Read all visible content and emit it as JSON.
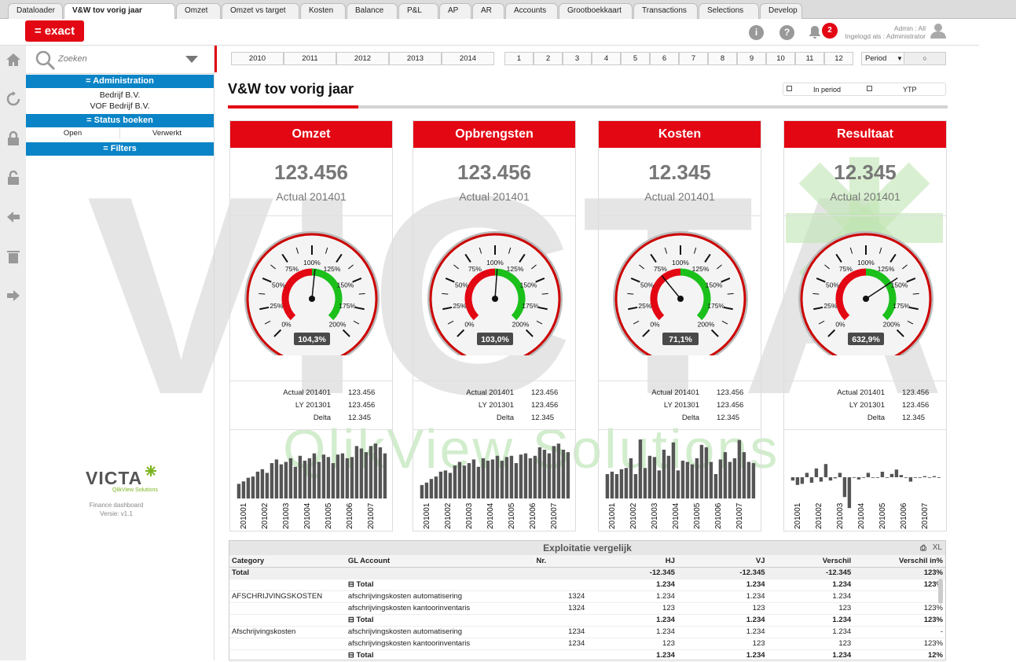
{
  "tabs": [
    {
      "label": "Dataloader",
      "active": false
    },
    {
      "label": "V&W tov vorig jaar",
      "active": true
    },
    {
      "label": "Omzet",
      "active": false
    },
    {
      "label": "Omzet vs target",
      "active": false
    },
    {
      "label": "Kosten",
      "active": false
    },
    {
      "label": "Balance",
      "active": false
    },
    {
      "label": "P&L",
      "active": false
    },
    {
      "label": "AP",
      "active": false
    },
    {
      "label": "AR",
      "active": false
    },
    {
      "label": "Accounts",
      "active": false
    },
    {
      "label": "Grootboekkaart",
      "active": false
    },
    {
      "label": "Transactions",
      "active": false
    },
    {
      "label": "Selections",
      "active": false
    },
    {
      "label": "Develop",
      "active": false
    }
  ],
  "header": {
    "logo": "= exact",
    "info_icon": "i",
    "help_icon": "?",
    "notification_count": "2",
    "user_line1": "Admin : All",
    "user_line2": "Ingelogd als : Administrator"
  },
  "sidebar": {
    "search_placeholder": "Zoeken",
    "administration_label": "= Administration",
    "companies": [
      "Bedrijf B.V.",
      "VOF Bedrijf B.V."
    ],
    "status_label": "= Status boeken",
    "status_open": "Open",
    "status_verwerkt": "Verwerkt",
    "filters_label": "= Filters",
    "brand": "VICTA",
    "brand_sub": "QlikView Solutions",
    "app_name": "Finance dashboard",
    "version": "Versie:  v1.1"
  },
  "years": [
    "2010",
    "2011",
    "2012",
    "2013",
    "2014"
  ],
  "months": [
    "1",
    "2",
    "3",
    "4",
    "5",
    "6",
    "7",
    "8",
    "9",
    "10",
    "11",
    "12"
  ],
  "period_select": "Period",
  "page_title": "V&W tov vorig jaar",
  "checkbox_in_period": "In period",
  "checkbox_ytp": "YTP",
  "watermark_text": "VICTA",
  "watermark_sub": "QlikView Solutions",
  "gauge_ticks": [
    "0%",
    "25%",
    "50%",
    "75%",
    "100%",
    "125%",
    "150%",
    "175%",
    "200%"
  ],
  "row_labels": {
    "actual": "Actual 201401",
    "ly": "LY 201301",
    "delta": "Delta"
  },
  "mini_axis_labels": [
    "201001",
    "201002",
    "201003",
    "201004",
    "201005",
    "201006",
    "201007"
  ],
  "cards": [
    {
      "title": "Omzet",
      "value": "123.456",
      "sub": "Actual 201401",
      "gauge_pct": 104.3,
      "gauge_label": "104,3%",
      "actual": "123.456",
      "ly": "123.456",
      "delta": "12.345",
      "bars": [
        12,
        14,
        17,
        18,
        22,
        24,
        21,
        29,
        32,
        28,
        30,
        33,
        26,
        35,
        31,
        33,
        37,
        30,
        36,
        34,
        29,
        36,
        37,
        33,
        34,
        43,
        41,
        38,
        43,
        45,
        42,
        37
      ]
    },
    {
      "title": "Opbrengsten",
      "value": "123.456",
      "sub": "Actual 201401",
      "gauge_pct": 103.0,
      "gauge_label": "103,0%",
      "actual": "123.456",
      "ly": "123.456",
      "delta": "12.345",
      "bars": [
        11,
        13,
        16,
        18,
        22,
        23,
        21,
        27,
        30,
        27,
        29,
        32,
        26,
        33,
        31,
        32,
        35,
        31,
        34,
        35,
        29,
        36,
        37,
        33,
        35,
        42,
        40,
        37,
        43,
        45,
        40,
        38
      ]
    },
    {
      "title": "Kosten",
      "value": "12.345",
      "sub": "Actual 201401",
      "gauge_pct": 71.1,
      "gauge_label": "71,1%",
      "actual": "123.456",
      "ly": "123.456",
      "delta": "12.345",
      "bars": [
        20,
        22,
        20,
        24,
        25,
        33,
        20,
        49,
        25,
        35,
        34,
        23,
        40,
        35,
        46,
        23,
        31,
        30,
        28,
        33,
        44,
        42,
        30,
        20,
        32,
        38,
        30,
        33,
        48,
        38,
        30,
        29
      ]
    },
    {
      "title": "Resultaat",
      "value": "12.345",
      "sub": "Actual 201401",
      "gauge_pct": 632.9,
      "gauge_label": "632,9%",
      "actual": "123.456",
      "ly": "123.456",
      "delta": "12.345",
      "bars": [
        -3,
        -7,
        -6,
        4,
        -5,
        8,
        -4,
        12,
        -3,
        -1,
        4,
        -18,
        -28,
        0,
        -2,
        0,
        4,
        0,
        0,
        5,
        0,
        3,
        7,
        2,
        0,
        -4,
        0,
        0,
        1,
        0,
        1,
        0
      ]
    }
  ],
  "table": {
    "title": "Exploitatie vergelijk",
    "export_label": "XL",
    "headers": [
      "Category",
      "GL Account",
      "Nr.",
      "HJ",
      "VJ",
      "Verschil",
      "Verschil in%"
    ],
    "rows": [
      {
        "cat": "Total",
        "gl": "",
        "nr": "",
        "hj": "-12.345",
        "vj": "-12.345",
        "vs": "-12.345",
        "vp": "123%",
        "bold": true,
        "gray": true
      },
      {
        "cat": "",
        "gl": "Total",
        "nr": "",
        "hj": "1.234",
        "vj": "1.234",
        "vs": "1.234",
        "vp": "123%",
        "bold": true,
        "tree": true
      },
      {
        "cat": "AFSCHRIJVINGSKOSTEN",
        "gl": "afschrijvingskosten automatisering",
        "nr": "1324",
        "hj": "1.234",
        "vj": "1.234",
        "vs": "1.234",
        "vp": "-"
      },
      {
        "cat": "",
        "gl": "afschrijvingskosten kantoorinventaris",
        "nr": "1324",
        "hj": "123",
        "vj": "123",
        "vs": "123",
        "vp": "123%"
      },
      {
        "cat": "",
        "gl": "Total",
        "nr": "",
        "hj": "1.234",
        "vj": "1.234",
        "vs": "1.234",
        "vp": "123%",
        "bold": true,
        "tree": true
      },
      {
        "cat": "Afschrijvingskosten",
        "gl": "afschrijvingskosten automatisering",
        "nr": "1234",
        "hj": "1.234",
        "vj": "1.234",
        "vs": "1.234",
        "vp": "-"
      },
      {
        "cat": "",
        "gl": "afschrijvingskosten kantoorinventaris",
        "nr": "1234",
        "hj": "123",
        "vj": "123",
        "vs": "123",
        "vp": "123%"
      },
      {
        "cat": "",
        "gl": "Total",
        "nr": "",
        "hj": "1.234",
        "vj": "1.234",
        "vs": "1.234",
        "vp": "12%",
        "bold": true,
        "tree": true
      }
    ]
  },
  "colors": {
    "brand_red": "#e30613",
    "admin_blue": "#0a84c6",
    "bar_gray": "#555555",
    "gauge_green": "#1bc01b"
  }
}
